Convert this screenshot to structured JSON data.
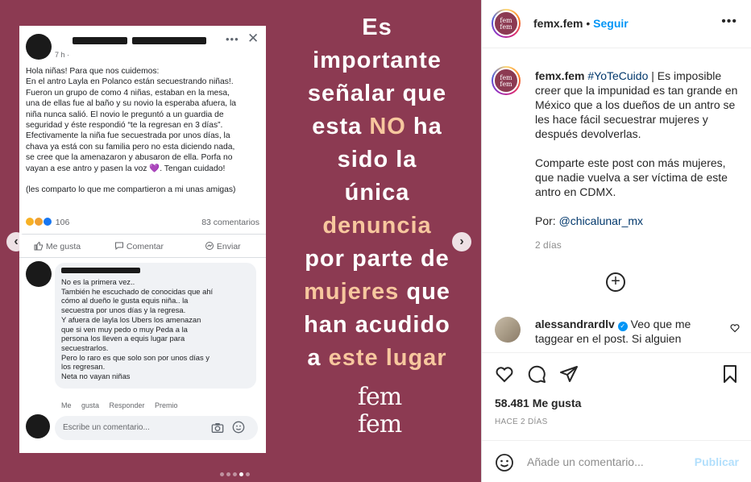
{
  "post_image": {
    "fb_post": {
      "time": "7 h · ",
      "more": "•••",
      "close": "✕",
      "body_lines": [
        "Hola niñas! Para que nos cuidemos:",
        "En el antro Layla en Polanco están secuestrando niñas!.",
        "Fueron un grupo de como 4 niñas, estaban en la mesa,",
        "una de ellas fue al baño y su novio la esperaba afuera, la",
        "niña nunca salió. El novio le preguntó a un guardia de",
        "seguridad y éste respondió “te la regresan en 3 días”.",
        "Efectivamente la niña fue secuestrada por unos días, la",
        "chava ya está con su familia pero no esta diciendo nada,",
        "se cree que la amenazaron y abusaron de ella.  Porfa no",
        "vayan a ese antro y pasen la voz 💜. Tengan cuidado!",
        "",
        "(les comparto lo que me compartieron a mi unas amigas)"
      ],
      "reactions_count": "106",
      "comments_count": "83 comentarios",
      "like_label": "Me gusta",
      "comment_label": "Comentar",
      "send_label": "Enviar",
      "comment_lines": [
        "No es la primera vez..",
        "También he escuchado de conocidas que ahí",
        "cómo al dueño le gusta equis niña.. la",
        "secuestra por unos días y la regresa.",
        "Y afuera de layla los Ubers los amenazan",
        "que si ven muy pedo o muy Peda a la",
        "persona los lleven a equis lugar para",
        "secuestrarlos.",
        "Pero lo raro es que solo son por unos días y",
        "los regresan.",
        "Neta no vayan niñas"
      ],
      "comment_actions": "Me gusta Responder Premio",
      "write_placeholder": "Escribe un comentario..."
    },
    "headline": {
      "line1": "Es",
      "line2": "importante",
      "line3": "señalar que",
      "line4_a": "esta ",
      "line4_hl": "NO",
      "line4_b": " ha",
      "line5": "sido la",
      "line6": "única",
      "line7_hl": "denuncia",
      "line8": "por parte de",
      "line9_hl": "mujeres",
      "line9_b": " que",
      "line10": "han acudido",
      "line11_a": "a ",
      "line11_hl": "este lugar"
    },
    "logo": {
      "top": "fem",
      "bottom": "fem"
    },
    "nav": {
      "prev": "‹",
      "next": "›"
    },
    "carousel": {
      "count": 5,
      "active_index": 3
    },
    "colors": {
      "background": "#8c3a52",
      "highlight": "#f7c79e"
    }
  },
  "panel": {
    "header": {
      "username": "femx.fem",
      "separator": " • ",
      "follow_label": "Seguir",
      "more": "•••",
      "avatar_text_1": "fem",
      "avatar_text_2": "fem"
    },
    "caption": {
      "username": "femx.fem",
      "hashtag": "#YoTeCuido",
      "text_1": " | Es imposible creer que la impunidad es tan grande en México que a los dueños de un antro se les hace fácil secuestrar mujeres y después devolverlas.",
      "text_2": "Comparte este post con más mujeres, que nadie vuelva a ser víctima de este antro en CDMX.",
      "text_3_prefix": "Por: ",
      "mention": "@chicalunar_mx",
      "time": "2 días"
    },
    "load_more": "+",
    "comment": {
      "username": "alessandrardlv",
      "verified": "✓",
      "text": " Veo que me taggear en el post. Si alguien necesita información..."
    },
    "likes": "58.481 Me gusta",
    "ago": "HACE 2 DÍAS",
    "add_comment": {
      "placeholder": "Añade un comentario...",
      "publish_label": "Publicar"
    },
    "colors": {
      "link": "#00376b",
      "follow": "#0095f6",
      "publish_disabled": "#b2dffc"
    }
  }
}
